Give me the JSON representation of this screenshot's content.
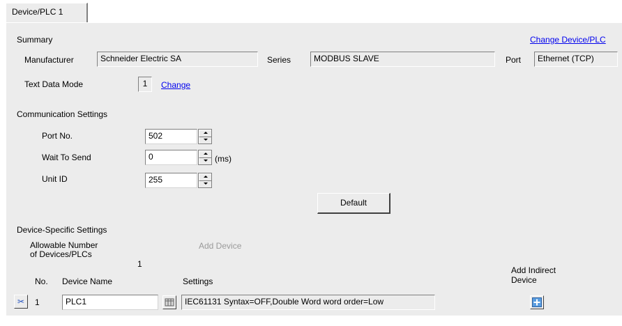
{
  "tab": {
    "label": "Device/PLC 1"
  },
  "summary": {
    "heading": "Summary",
    "change_device_link": "Change Device/PLC",
    "manufacturer_label": "Manufacturer",
    "manufacturer_value": "Schneider Electric SA",
    "series_label": "Series",
    "series_value": "MODBUS SLAVE",
    "port_label": "Port",
    "port_value": "Ethernet (TCP)",
    "text_data_mode_label": "Text Data Mode",
    "text_data_mode_value": "1",
    "change_link": "Change"
  },
  "communication": {
    "heading": "Communication Settings",
    "port_no_label": "Port No.",
    "port_no_value": "502",
    "wait_to_send_label": "Wait To Send",
    "wait_to_send_value": "0",
    "wait_unit": "(ms)",
    "unit_id_label": "Unit ID",
    "unit_id_value": "255",
    "default_button": "Default"
  },
  "device_specific": {
    "heading": "Device-Specific Settings",
    "allowable_line1": "Allowable Number",
    "allowable_line2": "of Devices/PLCs",
    "allowable_value": "1",
    "add_device": "Add Device",
    "col_no": "No.",
    "col_device_name": "Device Name",
    "col_settings": "Settings",
    "col_add_indirect_line1": "Add Indirect",
    "col_add_indirect_line2": "Device",
    "rows": [
      {
        "no": "1",
        "device_name": "PLC1",
        "settings": "IEC61131 Syntax=OFF,Double Word word order=Low"
      }
    ]
  }
}
